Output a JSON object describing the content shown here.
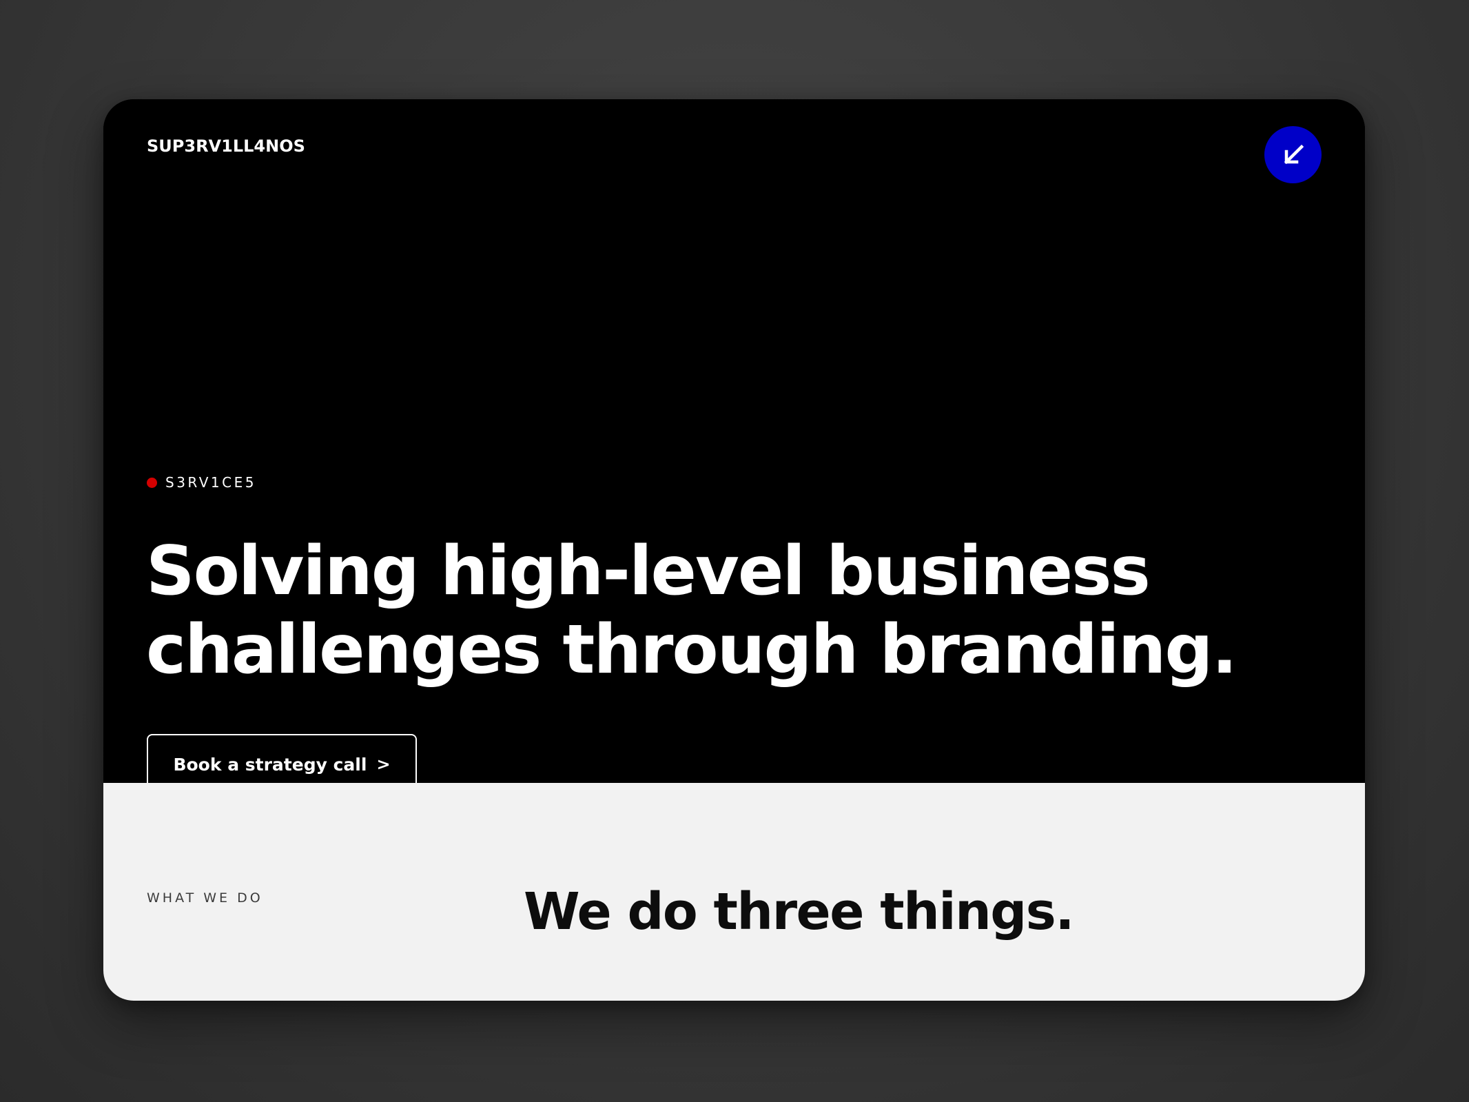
{
  "header": {
    "brand": "SUP3RV1LL4NOS",
    "corner_button_icon": "arrow-down-left-icon"
  },
  "hero": {
    "eyebrow": "S3RV1CE5",
    "headline_line1": "Solving high-level business",
    "headline_line2": "challenges through branding.",
    "cta_label": "Book a strategy call",
    "cta_chevron": ">"
  },
  "section": {
    "label": "WHAT WE DO",
    "title": "We do three things."
  },
  "colors": {
    "accent_blue": "#0000c8",
    "dot_red": "#d40000",
    "hero_bg": "#000000",
    "section_bg": "#f2f2f2"
  }
}
